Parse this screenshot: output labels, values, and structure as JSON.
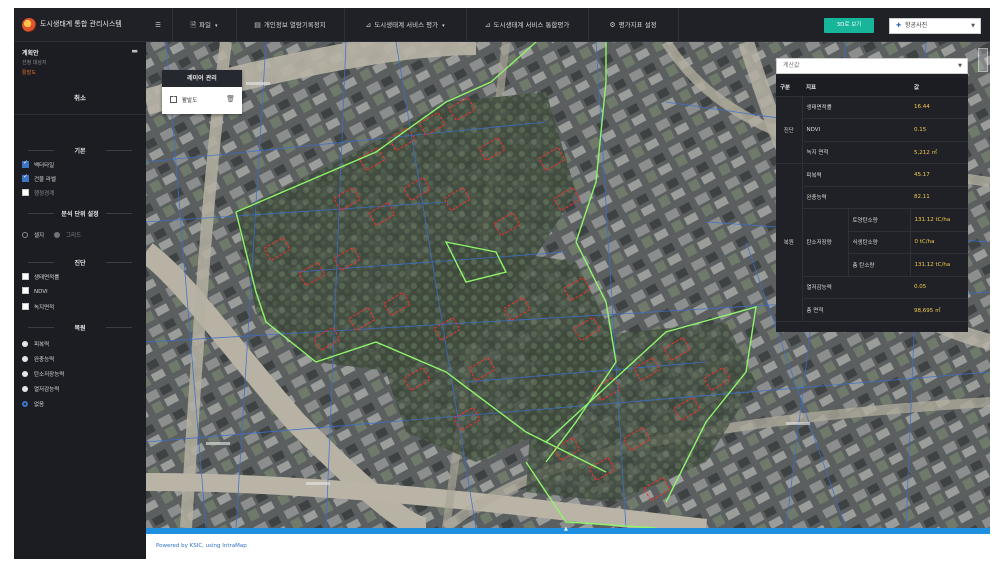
{
  "app": {
    "title": "도시생태계 통합 관리시스템"
  },
  "nav": {
    "menu_icon": "hamburger-icon",
    "items": [
      {
        "label": "파일",
        "icon": "file-icon",
        "has_dropdown": true
      },
      {
        "label": "개인정보 열람기록정지",
        "icon": "monitor-icon",
        "has_dropdown": false
      },
      {
        "label": "도시생태계 서비스 평가",
        "icon": "chart-icon",
        "has_dropdown": true
      },
      {
        "label": "도시생태계 서비스 통합평가",
        "icon": "chart-icon",
        "has_dropdown": false
      },
      {
        "label": "평가지표 설정",
        "icon": "gear-icon",
        "has_dropdown": false
      }
    ],
    "btn_3d": "3D로 보기",
    "basemap": "항공사진"
  },
  "sidebar": {
    "title": "계획안",
    "subtitle": "선정 대상지",
    "subtitle2": "활발도",
    "cancel": "취소",
    "sections": {
      "basic": {
        "title": "기본",
        "items": [
          {
            "label": "백터타일",
            "checked": true
          },
          {
            "label": "건물 라벨",
            "checked": true
          },
          {
            "label": "행정경계",
            "checked": false
          }
        ]
      },
      "unit": {
        "title": "분석 단위 설정",
        "options": [
          {
            "label": "셀지",
            "selected": false
          },
          {
            "label": "그리드",
            "selected": false
          }
        ]
      },
      "diagnosis": {
        "title": "진단",
        "items": [
          {
            "label": "생태면적률",
            "checked": false
          },
          {
            "label": "NDVI",
            "checked": false
          },
          {
            "label": "녹지면적",
            "checked": false
          }
        ]
      },
      "restore": {
        "title": "복원",
        "options": [
          {
            "label": "피복력",
            "selected": false
          },
          {
            "label": "완충능력",
            "selected": false
          },
          {
            "label": "탄소저장능력",
            "selected": false
          },
          {
            "label": "열저감능력",
            "selected": false
          },
          {
            "label": "없음",
            "selected": true
          }
        ]
      }
    }
  },
  "layer_panel": {
    "title": "레이어 관리",
    "layer_name": "활발도",
    "layer_checked": true
  },
  "result_panel": {
    "select_placeholder": "계산값",
    "headers": {
      "group": "구분",
      "indicator": "지표",
      "value": "값"
    },
    "group_diagnosis": "진단",
    "group_restore": "복원",
    "rows_diagnosis": [
      {
        "label": "생태면적률",
        "value": "16.44"
      },
      {
        "label": "NDVI",
        "value": "0.15"
      },
      {
        "label": "녹지 면적",
        "value": "5,212 ㎡"
      }
    ],
    "rows_restore_top": [
      {
        "label": "피복력",
        "value": "45.17"
      },
      {
        "label": "완충능력",
        "value": "82.11"
      }
    ],
    "carbon": {
      "label": "탄소저장량",
      "rows": [
        {
          "label": "토양탄소량",
          "value": "131.12 tC/ha"
        },
        {
          "label": "식생탄소량",
          "value": "0 tC/ha"
        },
        {
          "label": "총 탄소량",
          "value": "131.12 tC/ha"
        }
      ]
    },
    "rows_restore_bottom": [
      {
        "label": "열저감능력",
        "value": "0.05"
      },
      {
        "label": "총 면적",
        "value": "98,695 ㎡"
      }
    ]
  },
  "footer": {
    "text": "Powered by KSIC, using IntraMap"
  },
  "colors": {
    "accent_teal": "#17b59a",
    "value_yellow": "#f2c94c",
    "boundary_green": "#8ef56b",
    "parcel_red": "#e8322c",
    "footer_link": "#2f6fc0"
  }
}
